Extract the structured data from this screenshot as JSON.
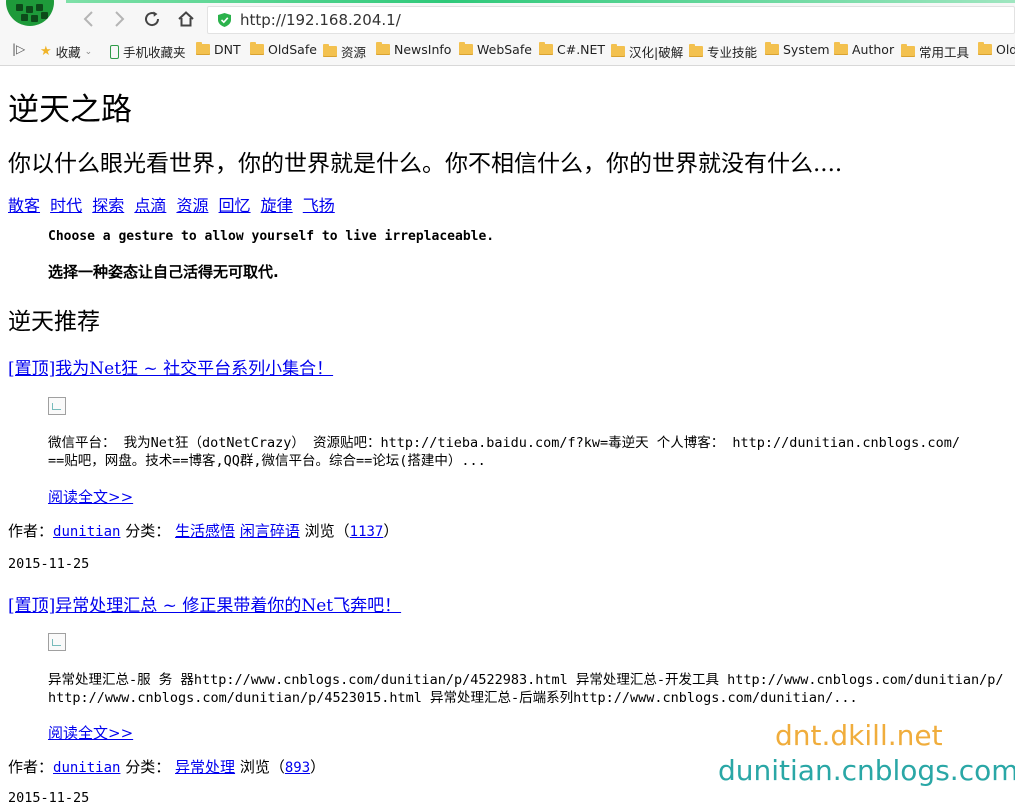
{
  "browser": {
    "url": "http://192.168.204.1/",
    "bookmarks": [
      {
        "label": "收藏",
        "icon": "star-icon"
      },
      {
        "label": "手机收藏夹",
        "icon": "phone-icon"
      },
      {
        "label": "DNT",
        "icon": "folder-icon"
      },
      {
        "label": "OldSafe",
        "icon": "folder-icon"
      },
      {
        "label": "资源",
        "icon": "folder-icon"
      },
      {
        "label": "NewsInfo",
        "icon": "folder-icon"
      },
      {
        "label": "WebSafe",
        "icon": "folder-icon"
      },
      {
        "label": "C#.NET",
        "icon": "folder-icon"
      },
      {
        "label": "汉化|破解",
        "icon": "folder-icon"
      },
      {
        "label": "专业技能",
        "icon": "folder-icon"
      },
      {
        "label": "System",
        "icon": "folder-icon"
      },
      {
        "label": "Author",
        "icon": "folder-icon"
      },
      {
        "label": "常用工具",
        "icon": "folder-icon"
      },
      {
        "label": "Old",
        "icon": "folder-icon"
      }
    ]
  },
  "site": {
    "title": "逆天之路",
    "subtitle": "你以什么眼光看世界，你的世界就是什么。你不相信什么，你的世界就没有什么....",
    "nav": [
      "散客",
      "时代",
      "探索",
      "点滴",
      "资源",
      "回忆",
      "旋律",
      "飞扬"
    ],
    "quote_en": "Choose a gesture to allow yourself to live irreplaceable.",
    "quote_zh": "选择一种姿态让自己活得无可取代.",
    "section_title": "逆天推荐"
  },
  "posts": [
    {
      "title": "[置顶]我为Net狂 ~ 社交平台系列小集合！",
      "excerpt_line1": "微信平台： 我为Net狂（dotNetCrazy） 资源贴吧：http://tieba.baidu.com/f?kw=毒逆天 个人博客： http://dunitian.cnblogs.com/",
      "excerpt_line2": "==贴吧，网盘。技术==博客,QQ群,微信平台。综合==论坛(搭建中）...",
      "read_more": "阅读全文>>",
      "author_label": "作者：",
      "author": "dunitian",
      "category_label": "分类：",
      "categories": [
        "生活感悟",
        "闲言碎语"
      ],
      "views_label": "浏览（",
      "views": "1137",
      "views_close": "）",
      "date": "2015-11-25"
    },
    {
      "title": "[置顶]异常处理汇总 ~ 修正果带着你的Net飞奔吧！",
      "excerpt_line1": "异常处理汇总-服 务 器http://www.cnblogs.com/dunitian/p/4522983.html 异常处理汇总-开发工具 http://www.cnblogs.com/dunitian/p/",
      "excerpt_line2": "http://www.cnblogs.com/dunitian/p/4523015.html 异常处理汇总-后端系列http://www.cnblogs.com/dunitian/...",
      "read_more": "阅读全文>>",
      "author_label": "作者：",
      "author": "dunitian",
      "category_label": "分类：",
      "categories": [
        "异常处理"
      ],
      "views_label": "浏览（",
      "views": "893",
      "views_close": "）",
      "date": "2015-11-25"
    }
  ],
  "watermark": {
    "line1": "dnt.dkill.net",
    "line2": "dunitian.cnblogs.com"
  }
}
